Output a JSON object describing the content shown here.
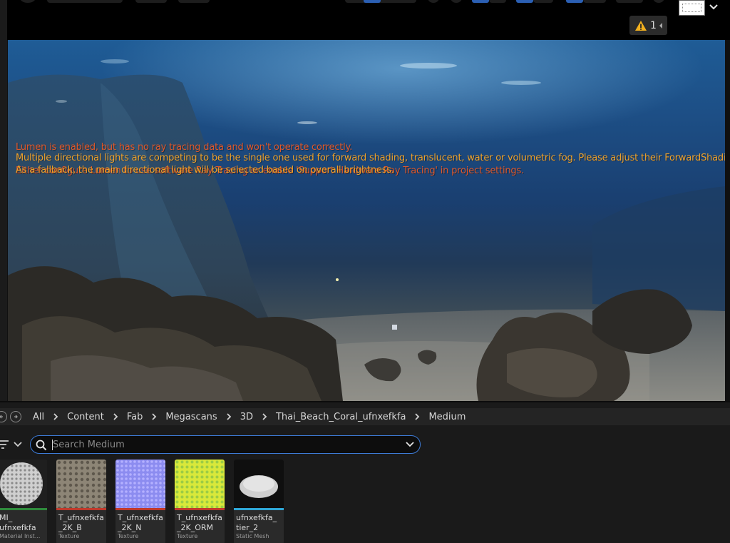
{
  "toolbar": {
    "warning_count": "1"
  },
  "viewport": {
    "messages": {
      "lumen": "Lumen is enabled, but has no ray tracing data and won't operate correctly.",
      "lights": "Multiple directional lights are competing to be the single one used for forward shading, translucent, water or volumetric fog. Please adjust their ForwardShadingPriority.",
      "ray_tracing": "Either configure Lumen to use software Ray Tracing or enable 'Support Hardware Ray Tracing' in project settings.",
      "fallback": "As a fallback, the main directional light will be selected based on overall brightness."
    }
  },
  "content_browser": {
    "breadcrumb": [
      "All",
      "Content",
      "Fab",
      "Megascans",
      "3D",
      "Thai_Beach_Coral_ufnxefkfa",
      "Medium"
    ],
    "search": {
      "value": "",
      "placeholder": "Search Medium"
    },
    "assets": [
      {
        "name": "MI_\nufnxefkfa",
        "type": "Material Inst...",
        "strip_color": "#2f8a3c",
        "thumb": "coral"
      },
      {
        "name": "T_ufnxefkfa\n_2K_B",
        "type": "Texture",
        "strip_color": "#c0392b",
        "thumb": "albedo"
      },
      {
        "name": "T_ufnxefkfa\n_2K_N",
        "type": "Texture",
        "strip_color": "#c0392b",
        "thumb": "normal"
      },
      {
        "name": "T_ufnxefkfa\n_2K_ORM",
        "type": "Texture",
        "strip_color": "#c0392b",
        "thumb": "orm"
      },
      {
        "name": "ufnxefkfa_\ntier_2",
        "type": "Static Mesh",
        "strip_color": "#2fa7d6",
        "thumb": "mesh"
      }
    ]
  },
  "colors": {
    "accent": "#3d7bd6",
    "warning_red": "#e0582a",
    "warning_orange": "#f0a22a"
  },
  "icons": {
    "warning": "warning-triangle-icon",
    "search": "magnifier-icon",
    "back": "back-circle-icon",
    "forward": "forward-circle-icon",
    "filter": "filter-icon"
  }
}
